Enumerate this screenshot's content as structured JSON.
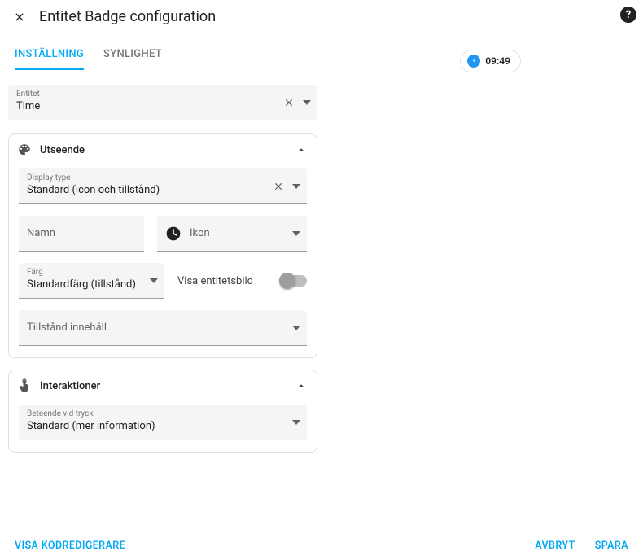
{
  "header": {
    "title": "Entitet Badge configuration"
  },
  "tabs": {
    "settings": "INSTÄLLNING",
    "visibility": "SYNLIGHET"
  },
  "preview": {
    "time": "09:49"
  },
  "entity": {
    "label": "Entitet",
    "value": "Time"
  },
  "appearance": {
    "title": "Utseende",
    "display_type": {
      "label": "Display type",
      "value": "Standard (icon och tillstånd)"
    },
    "name": {
      "placeholder": "Namn"
    },
    "icon": {
      "placeholder": "Ikon"
    },
    "color": {
      "label": "Färg",
      "value": "Standardfärg (tillstånd)"
    },
    "show_entity_picture": "Visa entitetsbild",
    "state_content": {
      "placeholder": "Tillstånd innehåll"
    }
  },
  "interactions": {
    "title": "Interaktioner",
    "tap": {
      "label": "Beteende vid tryck",
      "value": "Standard (mer information)"
    }
  },
  "footer": {
    "code_editor": "VISA KODREDIGERARE",
    "cancel": "AVBRYT",
    "save": "SPARA"
  }
}
